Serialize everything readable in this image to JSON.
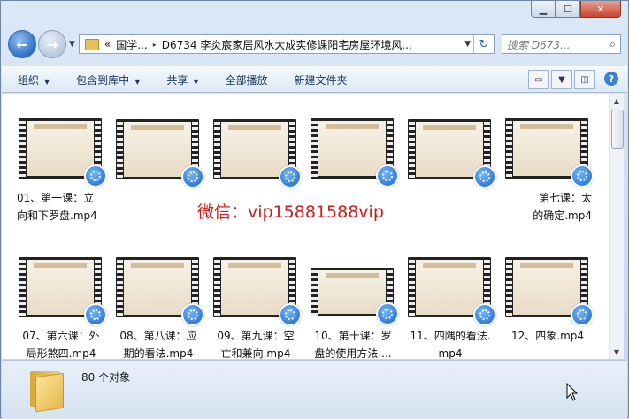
{
  "window": {
    "controls": {
      "minimize": "▁",
      "maximize": "☐",
      "close": "✕"
    }
  },
  "nav": {
    "back_icon": "arrow-left",
    "forward_icon": "arrow-right",
    "back": "←",
    "forward": "→",
    "history": "▼",
    "address": {
      "overflow": "«",
      "segments": [
        "国学...",
        "D6734 李炎宸家居风水大成实修课阳宅房屋环境风..."
      ],
      "separator": "▸",
      "dropdown": "▼",
      "refresh": "↻"
    },
    "search": {
      "placeholder": "搜索 D673...",
      "icon": "⌕"
    }
  },
  "toolbar": {
    "items": [
      {
        "label": "组织",
        "has_dropdown": true
      },
      {
        "label": "包含到库中",
        "has_dropdown": true
      },
      {
        "label": "共享",
        "has_dropdown": true
      },
      {
        "label": "全部播放",
        "has_dropdown": false
      },
      {
        "label": "新建文件夹",
        "has_dropdown": false
      }
    ],
    "dropdown_glyph": "▼",
    "view_icon": "▭",
    "view_dd": "▼",
    "pane_icon": "◫",
    "help": "?"
  },
  "files": [
    {
      "label": "01、第一课：立\n向和下罗盘.mp4",
      "align": "left"
    },
    {
      "label": "",
      "align": "center"
    },
    {
      "label": "",
      "align": "center"
    },
    {
      "label": "",
      "align": "center"
    },
    {
      "label": "",
      "align": "center"
    },
    {
      "label": "第七课：太\n的确定.mp4",
      "align": "right"
    },
    {
      "label": "07、第六课：外\n局形煞四.mp4",
      "align": "center"
    },
    {
      "label": "08、第八课：应\n期的看法.mp4",
      "align": "center"
    },
    {
      "label": "09、第九课：空\n亡和兼向.mp4",
      "align": "center"
    },
    {
      "label": "10、第十课：罗\n盘的使用方法....",
      "align": "center"
    },
    {
      "label": "11、四隅的看法.\nmp4",
      "align": "center"
    },
    {
      "label": "12、四象.mp4",
      "align": "center"
    }
  ],
  "watermark": "微信：vip15881588vip",
  "status": {
    "count": "80 个对象"
  },
  "colors": {
    "watermark": "#d11c1c",
    "accent": "#2f6fc2"
  }
}
